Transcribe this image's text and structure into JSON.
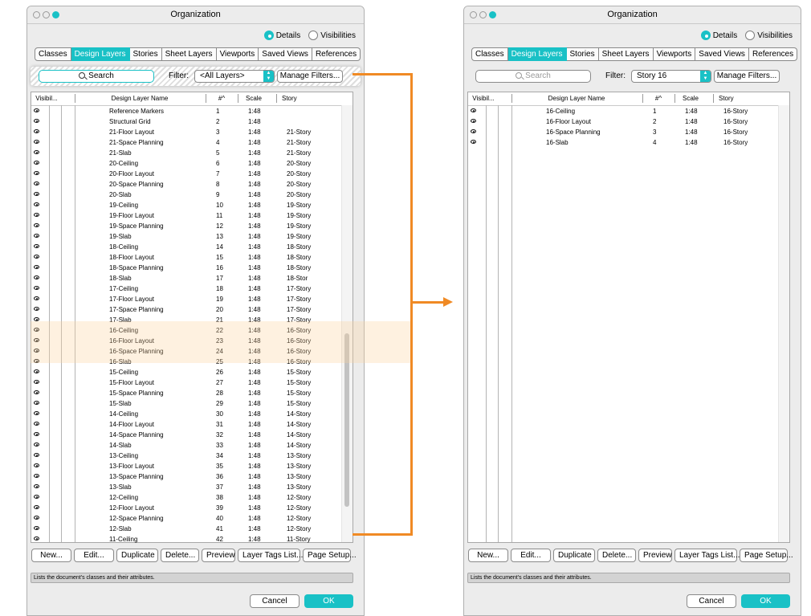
{
  "colors": {
    "accent": "#19c1c6",
    "connector": "#f08a24",
    "highlight": "#fdd2a0"
  },
  "left": {
    "title": "Organization",
    "view_options": [
      {
        "label": "Details",
        "selected": true
      },
      {
        "label": "Visibilities",
        "selected": false
      }
    ],
    "tabs": [
      "Classes",
      "Design Layers",
      "Stories",
      "Sheet Layers",
      "Viewports",
      "Saved Views",
      "References"
    ],
    "active_tab": "Design Layers",
    "search": {
      "placeholder": "Search"
    },
    "filter": {
      "label": "Filter:",
      "value": "<All Layers>",
      "manage": "Manage Filters..."
    },
    "columns": {
      "visibility": "Visibil...",
      "name": "Design Layer Name",
      "number": "#^",
      "scale": "Scale",
      "story": "Story"
    },
    "rows": [
      {
        "name": "Reference Markers",
        "num": "1",
        "scale": "1:48",
        "story": ""
      },
      {
        "name": "Structural Grid",
        "num": "2",
        "scale": "1:48",
        "story": ""
      },
      {
        "name": "21-Floor Layout",
        "num": "3",
        "scale": "1:48",
        "story": "21-Story"
      },
      {
        "name": "21-Space Planning",
        "num": "4",
        "scale": "1:48",
        "story": "21-Story"
      },
      {
        "name": "21-Slab",
        "num": "5",
        "scale": "1:48",
        "story": "21-Story"
      },
      {
        "name": "20-Ceiling",
        "num": "6",
        "scale": "1:48",
        "story": "20-Story"
      },
      {
        "name": "20-Floor Layout",
        "num": "7",
        "scale": "1:48",
        "story": "20-Story"
      },
      {
        "name": "20-Space Planning",
        "num": "8",
        "scale": "1:48",
        "story": "20-Story"
      },
      {
        "name": "20-Slab",
        "num": "9",
        "scale": "1:48",
        "story": "20-Story"
      },
      {
        "name": "19-Ceiling",
        "num": "10",
        "scale": "1:48",
        "story": "19-Story"
      },
      {
        "name": "19-Floor Layout",
        "num": "11",
        "scale": "1:48",
        "story": "19-Story"
      },
      {
        "name": "19-Space Planning",
        "num": "12",
        "scale": "1:48",
        "story": "19-Story"
      },
      {
        "name": "19-Slab",
        "num": "13",
        "scale": "1:48",
        "story": "19-Story"
      },
      {
        "name": "18-Ceiling",
        "num": "14",
        "scale": "1:48",
        "story": "18-Story"
      },
      {
        "name": "18-Floor Layout",
        "num": "15",
        "scale": "1:48",
        "story": "18-Story"
      },
      {
        "name": "18-Space Planning",
        "num": "16",
        "scale": "1:48",
        "story": "18-Story"
      },
      {
        "name": "18-Slab",
        "num": "17",
        "scale": "1:48",
        "story": "18-Stor"
      },
      {
        "name": "17-Ceiling",
        "num": "18",
        "scale": "1:48",
        "story": "17-Story"
      },
      {
        "name": "17-Floor Layout",
        "num": "19",
        "scale": "1:48",
        "story": "17-Story"
      },
      {
        "name": "17-Space Planning",
        "num": "20",
        "scale": "1:48",
        "story": "17-Story"
      },
      {
        "name": "17-Slab",
        "num": "21",
        "scale": "1:48",
        "story": "17-Story"
      },
      {
        "name": "16-Ceiling",
        "num": "22",
        "scale": "1:48",
        "story": "16-Story"
      },
      {
        "name": "16-Floor Layout",
        "num": "23",
        "scale": "1:48",
        "story": "16-Story"
      },
      {
        "name": "16-Space Planning",
        "num": "24",
        "scale": "1:48",
        "story": "16-Story"
      },
      {
        "name": "16-Slab",
        "num": "25",
        "scale": "1:48",
        "story": "16-Story"
      },
      {
        "name": "15-Ceiling",
        "num": "26",
        "scale": "1:48",
        "story": "15-Story"
      },
      {
        "name": "15-Floor Layout",
        "num": "27",
        "scale": "1:48",
        "story": "15-Story"
      },
      {
        "name": "15-Space Planning",
        "num": "28",
        "scale": "1:48",
        "story": "15-Story"
      },
      {
        "name": "15-Slab",
        "num": "29",
        "scale": "1:48",
        "story": "15-Story"
      },
      {
        "name": "14-Ceiling",
        "num": "30",
        "scale": "1:48",
        "story": "14-Story"
      },
      {
        "name": "14-Floor Layout",
        "num": "31",
        "scale": "1:48",
        "story": "14-Story"
      },
      {
        "name": "14-Space Planning",
        "num": "32",
        "scale": "1:48",
        "story": "14-Story"
      },
      {
        "name": "14-Slab",
        "num": "33",
        "scale": "1:48",
        "story": "14-Story"
      },
      {
        "name": "13-Ceiling",
        "num": "34",
        "scale": "1:48",
        "story": "13-Story"
      },
      {
        "name": "13-Floor Layout",
        "num": "35",
        "scale": "1:48",
        "story": "13-Story"
      },
      {
        "name": "13-Space Planning",
        "num": "36",
        "scale": "1:48",
        "story": "13-Story"
      },
      {
        "name": "13-Slab",
        "num": "37",
        "scale": "1:48",
        "story": "13-Story"
      },
      {
        "name": "12-Ceiling",
        "num": "38",
        "scale": "1:48",
        "story": "12-Story"
      },
      {
        "name": "12-Floor Layout",
        "num": "39",
        "scale": "1:48",
        "story": "12-Story"
      },
      {
        "name": "12-Space Planning",
        "num": "40",
        "scale": "1:48",
        "story": "12-Story"
      },
      {
        "name": "12-Slab",
        "num": "41",
        "scale": "1:48",
        "story": "12-Story"
      },
      {
        "name": "11-Ceiling",
        "num": "42",
        "scale": "1:48",
        "story": "11-Story"
      }
    ],
    "buttons": [
      "New...",
      "Edit...",
      "Duplicate",
      "Delete...",
      "Preview",
      "Layer Tags List...",
      "Page Setup..."
    ],
    "status": "Lists the document's classes and their attributes.",
    "cancel": "Cancel",
    "ok": "OK"
  },
  "right": {
    "title": "Organization",
    "view_options": [
      {
        "label": "Details",
        "selected": true
      },
      {
        "label": "Visibilities",
        "selected": false
      }
    ],
    "tabs": [
      "Classes",
      "Design Layers",
      "Stories",
      "Sheet Layers",
      "Viewports",
      "Saved Views",
      "References"
    ],
    "active_tab": "Design Layers",
    "search": {
      "placeholder": "Search"
    },
    "filter": {
      "label": "Filter:",
      "value": "Story 16",
      "manage": "Manage Filters..."
    },
    "columns": {
      "visibility": "Visibil...",
      "name": "Design Layer Name",
      "number": "#^",
      "scale": "Scale",
      "story": "Story"
    },
    "rows": [
      {
        "name": "16-Ceiling",
        "num": "1",
        "scale": "1:48",
        "story": "16-Story"
      },
      {
        "name": "16-Floor Layout",
        "num": "2",
        "scale": "1:48",
        "story": "16-Story"
      },
      {
        "name": "16-Space Planning",
        "num": "3",
        "scale": "1:48",
        "story": "16-Story"
      },
      {
        "name": "16-Slab",
        "num": "4",
        "scale": "1:48",
        "story": "16-Story"
      }
    ],
    "buttons": [
      "New...",
      "Edit...",
      "Duplicate",
      "Delete...",
      "Preview",
      "Layer Tags List...",
      "Page Setup..."
    ],
    "status": "Lists the document's classes and their attributes.",
    "cancel": "Cancel",
    "ok": "OK"
  }
}
